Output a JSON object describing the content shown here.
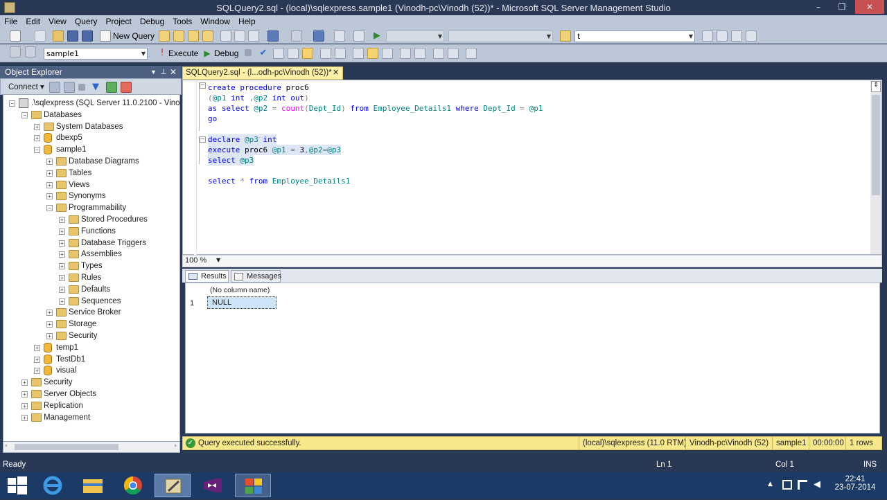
{
  "window": {
    "title": "SQLQuery2.sql - (local)\\sqlexpress.sample1 (Vinodh-pc\\Vinodh (52))* - Microsoft SQL Server Management Studio",
    "minimize": "–",
    "restore": "❐",
    "close": "✕"
  },
  "menu": [
    "File",
    "Edit",
    "View",
    "Query",
    "Project",
    "Debug",
    "Tools",
    "Window",
    "Help"
  ],
  "toolbar1": {
    "new_query": "New Query",
    "search_value": "t"
  },
  "toolbar2": {
    "database": "sample1",
    "execute": "Execute",
    "debug": "Debug"
  },
  "object_explorer": {
    "title": "Object Explorer",
    "connect": "Connect ▾",
    "nodes": [
      {
        "label": ".\\sqlexpress (SQL Server 11.0.2100 - Vinodh",
        "level": 0,
        "icon": "server-icon",
        "expander": "⊟"
      },
      {
        "label": "Databases",
        "level": 1,
        "icon": "folder-icon",
        "expander": "⊟"
      },
      {
        "label": "System Databases",
        "level": 2,
        "icon": "folder-icon",
        "expander": "⊞"
      },
      {
        "label": "dbexp5",
        "level": 2,
        "icon": "database-icon",
        "expander": "⊞"
      },
      {
        "label": "sample1",
        "level": 2,
        "icon": "database-icon",
        "expander": "⊟"
      },
      {
        "label": "Database Diagrams",
        "level": 3,
        "icon": "folder-icon",
        "expander": "⊞"
      },
      {
        "label": "Tables",
        "level": 3,
        "icon": "folder-icon",
        "expander": "⊞"
      },
      {
        "label": "Views",
        "level": 3,
        "icon": "folder-icon",
        "expander": "⊞"
      },
      {
        "label": "Synonyms",
        "level": 3,
        "icon": "folder-icon",
        "expander": "⊞"
      },
      {
        "label": "Programmability",
        "level": 3,
        "icon": "folder-icon",
        "expander": "⊟"
      },
      {
        "label": "Stored Procedures",
        "level": 4,
        "icon": "folder-icon",
        "expander": "⊞"
      },
      {
        "label": "Functions",
        "level": 4,
        "icon": "folder-icon",
        "expander": "⊞"
      },
      {
        "label": "Database Triggers",
        "level": 4,
        "icon": "folder-icon",
        "expander": "⊞"
      },
      {
        "label": "Assemblies",
        "level": 4,
        "icon": "folder-icon",
        "expander": "⊞"
      },
      {
        "label": "Types",
        "level": 4,
        "icon": "folder-icon",
        "expander": "⊞"
      },
      {
        "label": "Rules",
        "level": 4,
        "icon": "folder-icon",
        "expander": "⊞"
      },
      {
        "label": "Defaults",
        "level": 4,
        "icon": "folder-icon",
        "expander": "⊞"
      },
      {
        "label": "Sequences",
        "level": 4,
        "icon": "folder-icon",
        "expander": "⊞"
      },
      {
        "label": "Service Broker",
        "level": 3,
        "icon": "folder-icon",
        "expander": "⊞"
      },
      {
        "label": "Storage",
        "level": 3,
        "icon": "folder-icon",
        "expander": "⊞"
      },
      {
        "label": "Security",
        "level": 3,
        "icon": "folder-icon",
        "expander": "⊞"
      },
      {
        "label": "temp1",
        "level": 2,
        "icon": "database-icon",
        "expander": "⊞"
      },
      {
        "label": "TestDb1",
        "level": 2,
        "icon": "database-icon",
        "expander": "⊞"
      },
      {
        "label": "visual",
        "level": 2,
        "icon": "database-icon",
        "expander": "⊞"
      },
      {
        "label": "Security",
        "level": 1,
        "icon": "folder-icon",
        "expander": "⊞"
      },
      {
        "label": "Server Objects",
        "level": 1,
        "icon": "folder-icon",
        "expander": "⊞"
      },
      {
        "label": "Replication",
        "level": 1,
        "icon": "folder-icon",
        "expander": "⊞"
      },
      {
        "label": "Management",
        "level": 1,
        "icon": "folder-icon",
        "expander": "⊞"
      }
    ]
  },
  "editor": {
    "tab_title": "SQLQuery2.sql - (l...odh-pc\\Vinodh (52))*",
    "tab_close": "✕",
    "code": {
      "l1a": "create procedure",
      "l1b": " proc6",
      "l2a": "(",
      "l2b": "@p1",
      "l2c": " int",
      "l2d": " ,",
      "l2e": "@p2",
      "l2f": " int out",
      "l2g": ")",
      "l3a": "as select",
      "l3b": " @p2",
      "l3c": " =",
      "l3d": " count",
      "l3e": "(",
      "l3f": "Dept_Id",
      "l3g": ")",
      "l3h": " from",
      "l3i": " Employee_Details1",
      "l3j": " where",
      "l3k": " Dept_Id",
      "l3l": " =",
      "l3m": " @p1",
      "l4": "go",
      "l5a": "declare",
      "l5b": " @p3",
      "l5c": " int",
      "l6a": "execute",
      "l6b": " proc6",
      "l6c": " @p1",
      "l6d": " =",
      "l6e": " 3",
      "l6f": ",",
      "l6g": "@p2",
      "l6h": "=",
      "l6i": "@p3",
      "l7a": "select",
      "l7b": " @p3",
      "l8a": "select",
      "l8b": " *",
      "l8c": " from",
      "l8d": " Employee_Details1"
    },
    "zoom": "100 %"
  },
  "results": {
    "tabs": [
      "Results",
      "Messages"
    ],
    "column": "(No column name)",
    "row_number": "1",
    "value": "NULL"
  },
  "status": {
    "message": "Query executed successfully.",
    "server": "(local)\\sqlexpress (11.0 RTM)",
    "user": "Vinodh-pc\\Vinodh (52)",
    "database": "sample1",
    "time": "00:00:00",
    "rows": "1 rows"
  },
  "app_status": {
    "ready": "Ready",
    "ln": "Ln 1",
    "col": "Col 1",
    "ins": "INS"
  },
  "taskbar": {
    "time": "22:41",
    "date": "23-07-2014",
    "tray_up": "▲"
  },
  "colors": {
    "accent": "#293955",
    "status_yellow": "#f8e88c",
    "keyword": "#0000ff",
    "function": "#ff00ff",
    "identifier": "#008080"
  }
}
